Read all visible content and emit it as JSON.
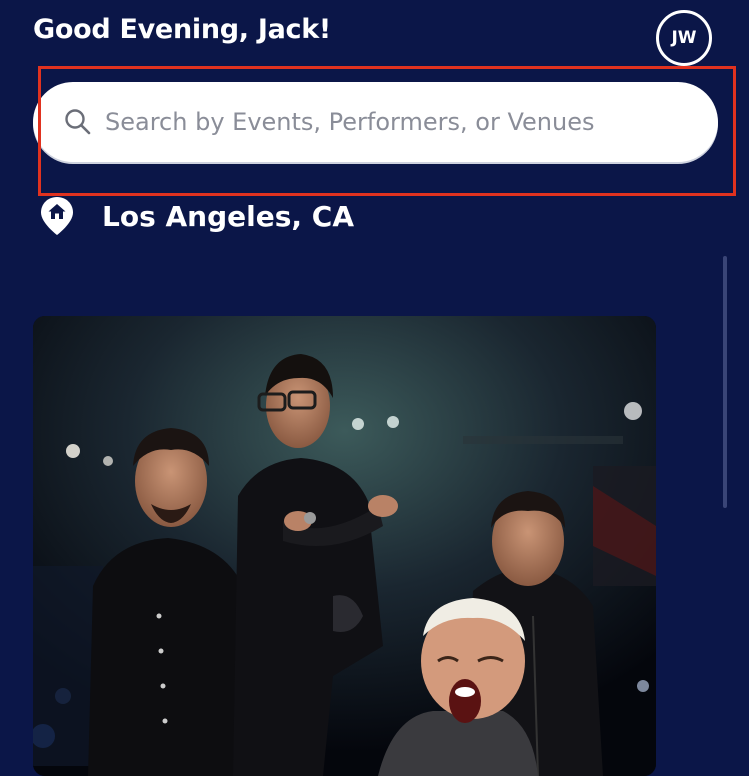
{
  "header": {
    "greeting": "Good Evening, Jack!",
    "avatar_initials": "JW"
  },
  "search": {
    "placeholder": "Search by Events, Performers, or Venues",
    "value": ""
  },
  "location": {
    "label": "Los Angeles, CA",
    "icon": "location-home-pin-icon"
  },
  "featured_event": {
    "image": "band-group-photo"
  },
  "colors": {
    "background": "#0b1648",
    "highlight": "#e0321f",
    "search_bg": "#ffffff"
  }
}
